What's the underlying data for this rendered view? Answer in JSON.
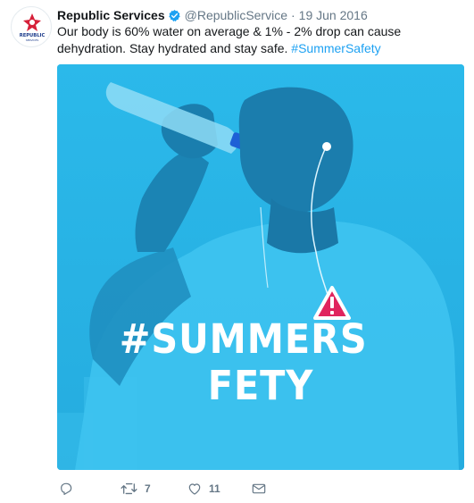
{
  "tweet": {
    "author_name": "Republic Services",
    "handle": "@RepublicService",
    "separator": "·",
    "date": "19 Jun 2016",
    "text_before": "Our body is 60% water on average & 1% - 2% drop can cause dehydration. Stay hydrated and stay safe. ",
    "hashtag": "#SummerSafety",
    "avatar_logo_text": "REPUBLIC",
    "avatar_logo_sub": "SERVICES"
  },
  "media": {
    "overlay_text": "#SUMMERS",
    "overlay_text_end": "FETY",
    "accent_color": "#29b6e8",
    "warning_color": "#e0245e"
  },
  "actions": {
    "reply_icon": "reply-icon",
    "retweet_count": "7",
    "like_count": "11",
    "dm_icon": "envelope-icon"
  },
  "colors": {
    "link": "#1da1f2",
    "muted": "#657786",
    "verified": "#1da1f2"
  }
}
